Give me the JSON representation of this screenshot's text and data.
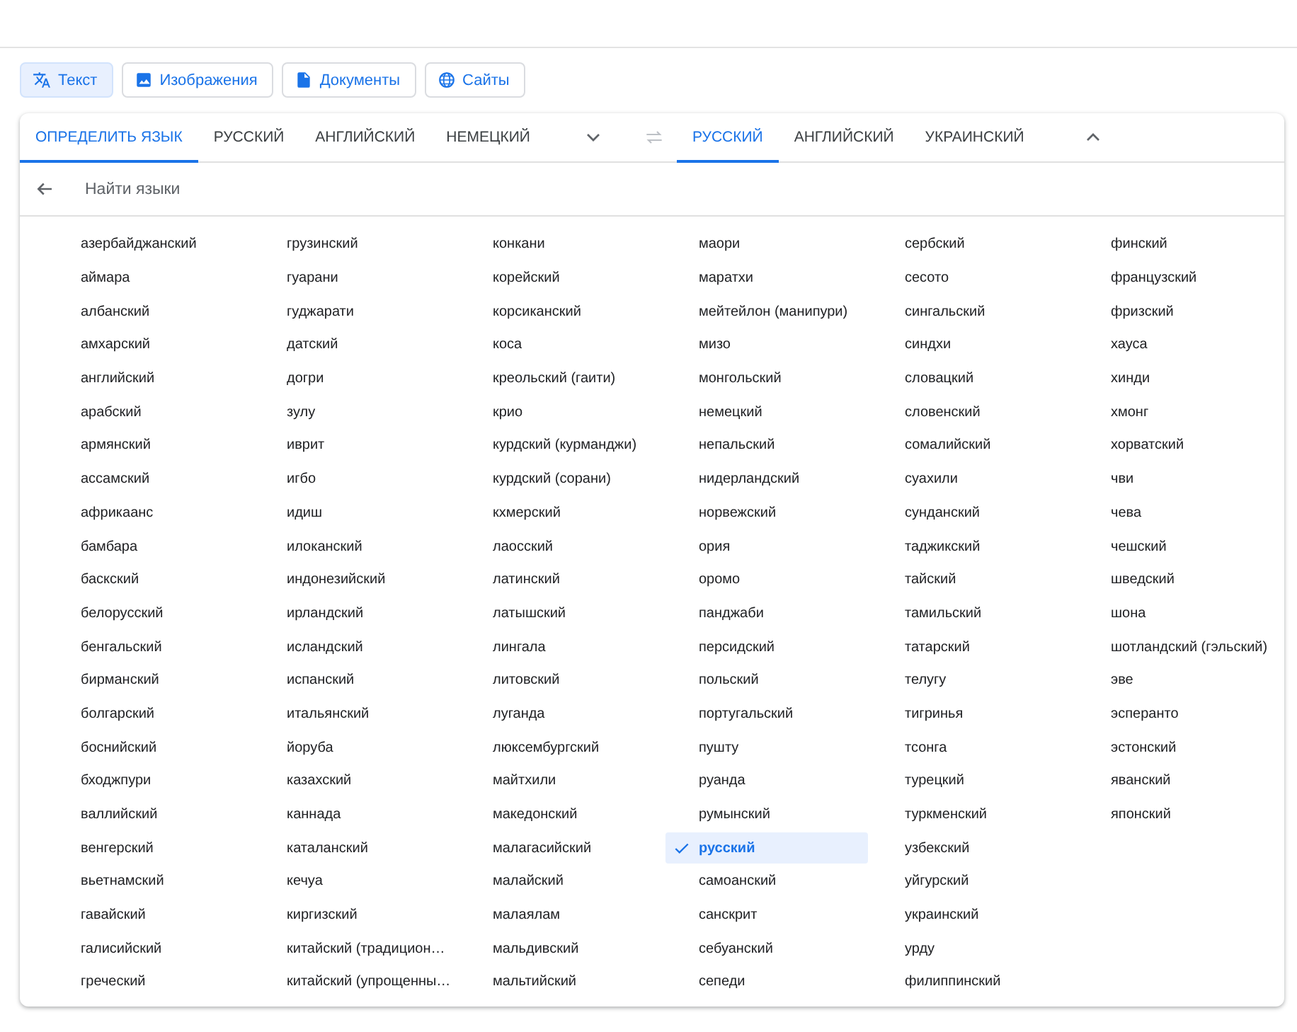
{
  "modes": [
    {
      "label": "Текст",
      "selected": true
    },
    {
      "label": "Изображения",
      "selected": false
    },
    {
      "label": "Документы",
      "selected": false
    },
    {
      "label": "Сайты",
      "selected": false
    }
  ],
  "source_tabs": [
    {
      "label": "ОПРЕДЕЛИТЬ ЯЗЫК",
      "selected": true
    },
    {
      "label": "РУССКИЙ",
      "selected": false
    },
    {
      "label": "АНГЛИЙСКИЙ",
      "selected": false
    },
    {
      "label": "НЕМЕЦКИЙ",
      "selected": false
    }
  ],
  "target_tabs": [
    {
      "label": "РУССКИЙ",
      "selected": true
    },
    {
      "label": "АНГЛИЙСКИЙ",
      "selected": false
    },
    {
      "label": "УКРАИНСКИЙ",
      "selected": false
    }
  ],
  "search": {
    "placeholder": "Найти языки"
  },
  "languages": [
    {
      "name": "азербайджанский",
      "selected": false
    },
    {
      "name": "аймара",
      "selected": false
    },
    {
      "name": "албанский",
      "selected": false
    },
    {
      "name": "амхарский",
      "selected": false
    },
    {
      "name": "английский",
      "selected": false
    },
    {
      "name": "арабский",
      "selected": false
    },
    {
      "name": "армянский",
      "selected": false
    },
    {
      "name": "ассамский",
      "selected": false
    },
    {
      "name": "африкаанс",
      "selected": false
    },
    {
      "name": "бамбара",
      "selected": false
    },
    {
      "name": "баскский",
      "selected": false
    },
    {
      "name": "белорусский",
      "selected": false
    },
    {
      "name": "бенгальский",
      "selected": false
    },
    {
      "name": "бирманский",
      "selected": false
    },
    {
      "name": "болгарский",
      "selected": false
    },
    {
      "name": "боснийский",
      "selected": false
    },
    {
      "name": "бходжпури",
      "selected": false
    },
    {
      "name": "валлийский",
      "selected": false
    },
    {
      "name": "венгерский",
      "selected": false
    },
    {
      "name": "вьетнамский",
      "selected": false
    },
    {
      "name": "гавайский",
      "selected": false
    },
    {
      "name": "галисийский",
      "selected": false
    },
    {
      "name": "греческий",
      "selected": false
    },
    {
      "name": "грузинский",
      "selected": false
    },
    {
      "name": "гуарани",
      "selected": false
    },
    {
      "name": "гуджарати",
      "selected": false
    },
    {
      "name": "датский",
      "selected": false
    },
    {
      "name": "догри",
      "selected": false
    },
    {
      "name": "зулу",
      "selected": false
    },
    {
      "name": "иврит",
      "selected": false
    },
    {
      "name": "игбо",
      "selected": false
    },
    {
      "name": "идиш",
      "selected": false
    },
    {
      "name": "илоканский",
      "selected": false
    },
    {
      "name": "индонезийский",
      "selected": false
    },
    {
      "name": "ирландский",
      "selected": false
    },
    {
      "name": "исландский",
      "selected": false
    },
    {
      "name": "испанский",
      "selected": false
    },
    {
      "name": "итальянский",
      "selected": false
    },
    {
      "name": "йоруба",
      "selected": false
    },
    {
      "name": "казахский",
      "selected": false
    },
    {
      "name": "каннада",
      "selected": false
    },
    {
      "name": "каталанский",
      "selected": false
    },
    {
      "name": "кечуа",
      "selected": false
    },
    {
      "name": "киргизский",
      "selected": false
    },
    {
      "name": "китайский (традицион…",
      "selected": false
    },
    {
      "name": "китайский (упрощенны…",
      "selected": false
    },
    {
      "name": "конкани",
      "selected": false
    },
    {
      "name": "корейский",
      "selected": false
    },
    {
      "name": "корсиканский",
      "selected": false
    },
    {
      "name": "коса",
      "selected": false
    },
    {
      "name": "креольский (гаити)",
      "selected": false
    },
    {
      "name": "крио",
      "selected": false
    },
    {
      "name": "курдский (курманджи)",
      "selected": false
    },
    {
      "name": "курдский (сорани)",
      "selected": false
    },
    {
      "name": "кхмерский",
      "selected": false
    },
    {
      "name": "лаосский",
      "selected": false
    },
    {
      "name": "латинский",
      "selected": false
    },
    {
      "name": "латышский",
      "selected": false
    },
    {
      "name": "лингала",
      "selected": false
    },
    {
      "name": "литовский",
      "selected": false
    },
    {
      "name": "луганда",
      "selected": false
    },
    {
      "name": "люксембургский",
      "selected": false
    },
    {
      "name": "майтхили",
      "selected": false
    },
    {
      "name": "македонский",
      "selected": false
    },
    {
      "name": "малагасийский",
      "selected": false
    },
    {
      "name": "малайский",
      "selected": false
    },
    {
      "name": "малаялам",
      "selected": false
    },
    {
      "name": "мальдивский",
      "selected": false
    },
    {
      "name": "мальтийский",
      "selected": false
    },
    {
      "name": "маори",
      "selected": false
    },
    {
      "name": "маратхи",
      "selected": false
    },
    {
      "name": "мейтейлон (манипури)",
      "selected": false
    },
    {
      "name": "мизо",
      "selected": false
    },
    {
      "name": "монгольский",
      "selected": false
    },
    {
      "name": "немецкий",
      "selected": false
    },
    {
      "name": "непальский",
      "selected": false
    },
    {
      "name": "нидерландский",
      "selected": false
    },
    {
      "name": "норвежский",
      "selected": false
    },
    {
      "name": "ория",
      "selected": false
    },
    {
      "name": "оромо",
      "selected": false
    },
    {
      "name": "панджаби",
      "selected": false
    },
    {
      "name": "персидский",
      "selected": false
    },
    {
      "name": "польский",
      "selected": false
    },
    {
      "name": "португальский",
      "selected": false
    },
    {
      "name": "пушту",
      "selected": false
    },
    {
      "name": "руанда",
      "selected": false
    },
    {
      "name": "румынский",
      "selected": false
    },
    {
      "name": "русский",
      "selected": true
    },
    {
      "name": "самоанский",
      "selected": false
    },
    {
      "name": "санскрит",
      "selected": false
    },
    {
      "name": "себуанский",
      "selected": false
    },
    {
      "name": "сепеди",
      "selected": false
    },
    {
      "name": "сербский",
      "selected": false
    },
    {
      "name": "сесото",
      "selected": false
    },
    {
      "name": "сингальский",
      "selected": false
    },
    {
      "name": "синдхи",
      "selected": false
    },
    {
      "name": "словацкий",
      "selected": false
    },
    {
      "name": "словенский",
      "selected": false
    },
    {
      "name": "сомалийский",
      "selected": false
    },
    {
      "name": "суахили",
      "selected": false
    },
    {
      "name": "сунданский",
      "selected": false
    },
    {
      "name": "таджикский",
      "selected": false
    },
    {
      "name": "тайский",
      "selected": false
    },
    {
      "name": "тамильский",
      "selected": false
    },
    {
      "name": "татарский",
      "selected": false
    },
    {
      "name": "телугу",
      "selected": false
    },
    {
      "name": "тигринья",
      "selected": false
    },
    {
      "name": "тсонга",
      "selected": false
    },
    {
      "name": "турецкий",
      "selected": false
    },
    {
      "name": "туркменский",
      "selected": false
    },
    {
      "name": "узбекский",
      "selected": false
    },
    {
      "name": "уйгурский",
      "selected": false
    },
    {
      "name": "украинский",
      "selected": false
    },
    {
      "name": "урду",
      "selected": false
    },
    {
      "name": "филиппинский",
      "selected": false
    },
    {
      "name": "финский",
      "selected": false
    },
    {
      "name": "французский",
      "selected": false
    },
    {
      "name": "фризский",
      "selected": false
    },
    {
      "name": "хауса",
      "selected": false
    },
    {
      "name": "хинди",
      "selected": false
    },
    {
      "name": "хмонг",
      "selected": false
    },
    {
      "name": "хорватский",
      "selected": false
    },
    {
      "name": "чви",
      "selected": false
    },
    {
      "name": "чева",
      "selected": false
    },
    {
      "name": "чешский",
      "selected": false
    },
    {
      "name": "шведский",
      "selected": false
    },
    {
      "name": "шона",
      "selected": false
    },
    {
      "name": "шотландский (гэльский)",
      "selected": false
    },
    {
      "name": "эве",
      "selected": false
    },
    {
      "name": "эсперанто",
      "selected": false
    },
    {
      "name": "эстонский",
      "selected": false
    },
    {
      "name": "яванский",
      "selected": false
    },
    {
      "name": "японский",
      "selected": false
    }
  ]
}
